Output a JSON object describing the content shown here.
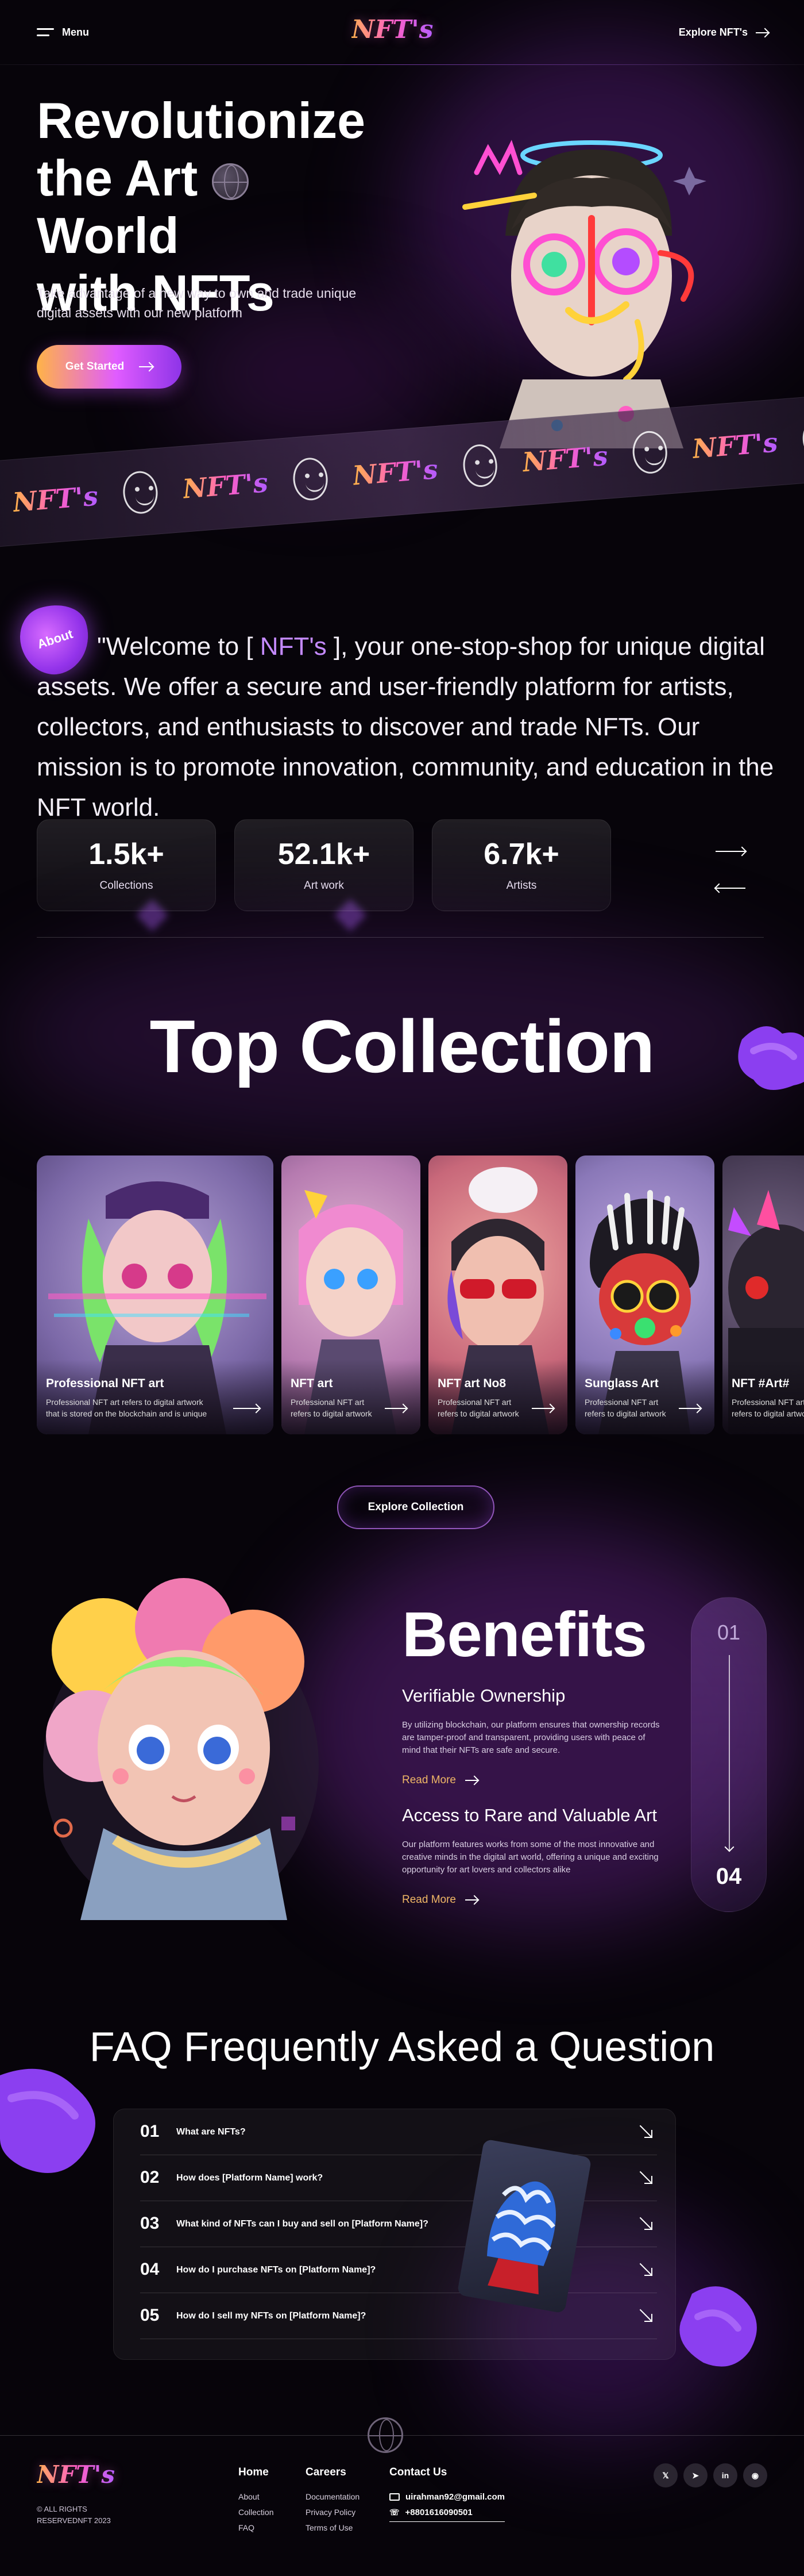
{
  "header": {
    "menu_label": "Menu",
    "logo": "NFT's",
    "explore_label": "Explore NFT's"
  },
  "hero": {
    "title_line1": "Revolutionize",
    "title_line2a": "the Art",
    "title_line2b": "World",
    "title_line3": "with NFTs",
    "subtitle": "Take advantage of a new way to own and trade unique digital assets with our new platform",
    "cta_label": "Get Started"
  },
  "ribbon": {
    "logo_text": "NFT's"
  },
  "about": {
    "badge": "About",
    "text_before": "\"Welcome to [ ",
    "text_brand": "NFT's",
    "text_after": " ], your one-stop-shop for unique digital assets. We offer a secure and user-friendly platform for artists, collectors, and enthusiasts to discover and trade NFTs. Our mission is to promote innovation, community, and education in the NFT world.",
    "stats": [
      {
        "value": "1.5k+",
        "label": "Collections"
      },
      {
        "value": "52.1k+",
        "label": "Art work"
      },
      {
        "value": "6.7k+",
        "label": "Artists"
      }
    ]
  },
  "collection": {
    "title": "Top Collection",
    "cards": [
      {
        "title": "Professional NFT art",
        "desc": "Professional NFT art refers to digital artwork that is stored on the blockchain and is unique"
      },
      {
        "title": "NFT art",
        "desc": "Professional NFT art refers to digital artwork"
      },
      {
        "title": "NFT art No8",
        "desc": "Professional NFT art refers to digital artwork"
      },
      {
        "title": "Sunglass Art",
        "desc": "Professional NFT art refers to digital artwork"
      },
      {
        "title": "NFT #Art#",
        "desc": "Professional NFT art refers to digital artwork"
      }
    ],
    "explore_label": "Explore Collection"
  },
  "benefits": {
    "title": "Benefits",
    "items": [
      {
        "heading": "Verifiable Ownership",
        "text": "By utilizing blockchain, our platform ensures that ownership records are tamper-proof and transparent, providing users with peace of mind that their NFTs are safe and secure.",
        "link": "Read More"
      },
      {
        "heading": "Access to Rare and Valuable Art",
        "text": "Our platform features works from some of the most innovative and creative minds in the digital art world, offering a unique and exciting opportunity for art lovers and collectors alike",
        "link": "Read More"
      }
    ],
    "pager_start": "01",
    "pager_end": "04"
  },
  "faq": {
    "title": "FAQ Frequently Asked a Question",
    "items": [
      {
        "num": "01",
        "q": "What are NFTs?"
      },
      {
        "num": "02",
        "q": "How does [Platform Name] work?"
      },
      {
        "num": "03",
        "q": "What kind of NFTs can I buy and sell on [Platform Name]?"
      },
      {
        "num": "04",
        "q": "How do I purchase NFTs on [Platform Name]?"
      },
      {
        "num": "05",
        "q": "How do I sell my NFTs on [Platform Name]?"
      }
    ]
  },
  "footer": {
    "logo": "NFT's",
    "copyright_line1": "© ALL RIGHTS",
    "copyright_line2": "RESERVEDNFT 2023",
    "home_heading": "Home",
    "home_links": [
      "About",
      "Collection",
      "FAQ"
    ],
    "careers_heading": "Careers",
    "careers_links": [
      "Documentation",
      "Privacy Policy",
      "Terms of Use"
    ],
    "contact_heading": "Contact Us",
    "email": "uirahman92@gmail.com",
    "phone": "+8801616090501",
    "social": [
      "twitter-icon",
      "telegram-icon",
      "linkedin-icon",
      "github-icon"
    ]
  },
  "colors": {
    "accent_purple": "#b05cff",
    "accent_orange": "#f0b766",
    "background": "#07040a"
  }
}
